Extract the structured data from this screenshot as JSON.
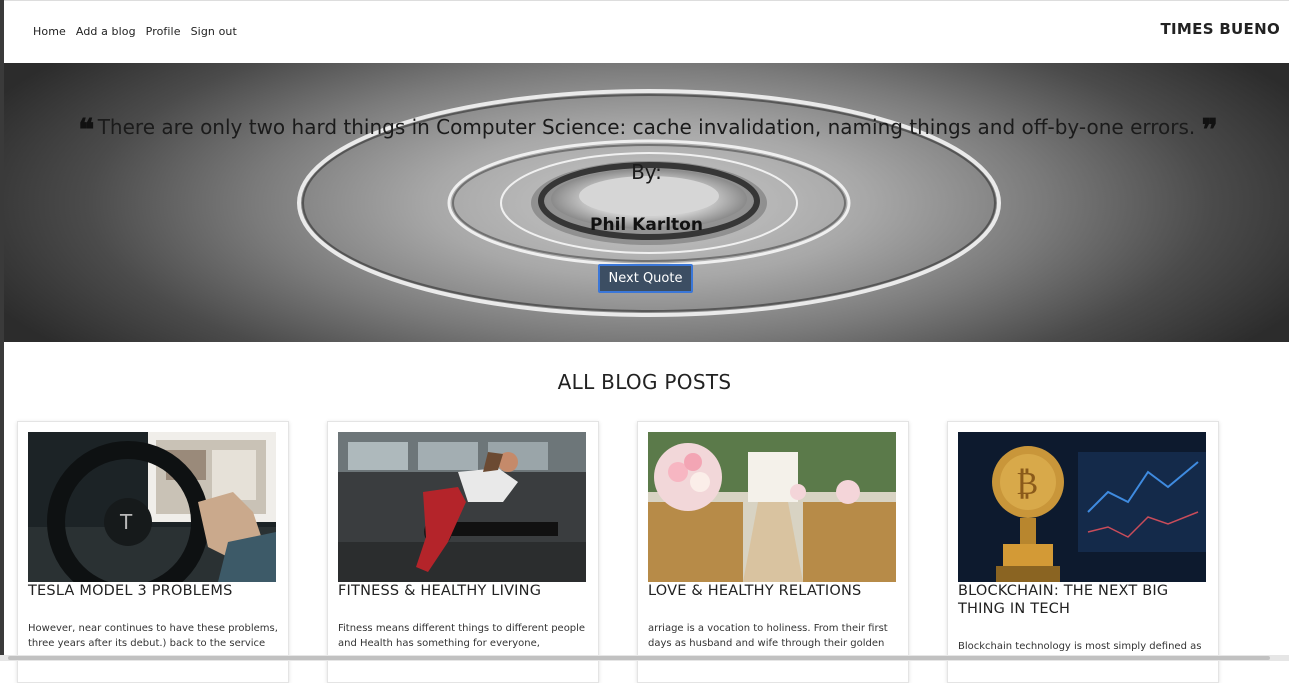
{
  "nav": {
    "links": [
      "Home",
      "Add a blog",
      "Profile",
      "Sign out"
    ],
    "brand": "TIMES BUENO"
  },
  "hero": {
    "open_quote_icon": "quote-left-icon",
    "close_quote_icon": "quote-right-icon",
    "quote": "There are only two hard things in Computer Science: cache invalidation, naming things and off-by-one errors.",
    "by_label": "By:",
    "author": "Phil Karlton",
    "button_label": "Next Quote",
    "button_color": "#3c4e63",
    "button_border": "#3b77d8"
  },
  "posts": {
    "heading": "ALL BLOG POSTS",
    "cards": [
      {
        "title": "TESLA MODEL 3 PROBLEMS",
        "excerpt": "However, near continues to have these problems, three years after its debut.) back to the service",
        "image": "tesla-interior-image"
      },
      {
        "title": "FITNESS & HEALTHY LIVING",
        "excerpt": "Fitness means different things to different people and Health has something for everyone,",
        "image": "gym-workout-image"
      },
      {
        "title": "LOVE & HEALTHY RELATIONS",
        "excerpt": "arriage is a vocation to holiness. From their first days as husband and wife through their golden",
        "image": "wedding-aisle-image"
      },
      {
        "title": "BLOCKCHAIN: THE NEXT BIG THING IN TECH",
        "excerpt": "Blockchain technology is most simply defined as",
        "image": "bitcoin-image"
      }
    ]
  }
}
